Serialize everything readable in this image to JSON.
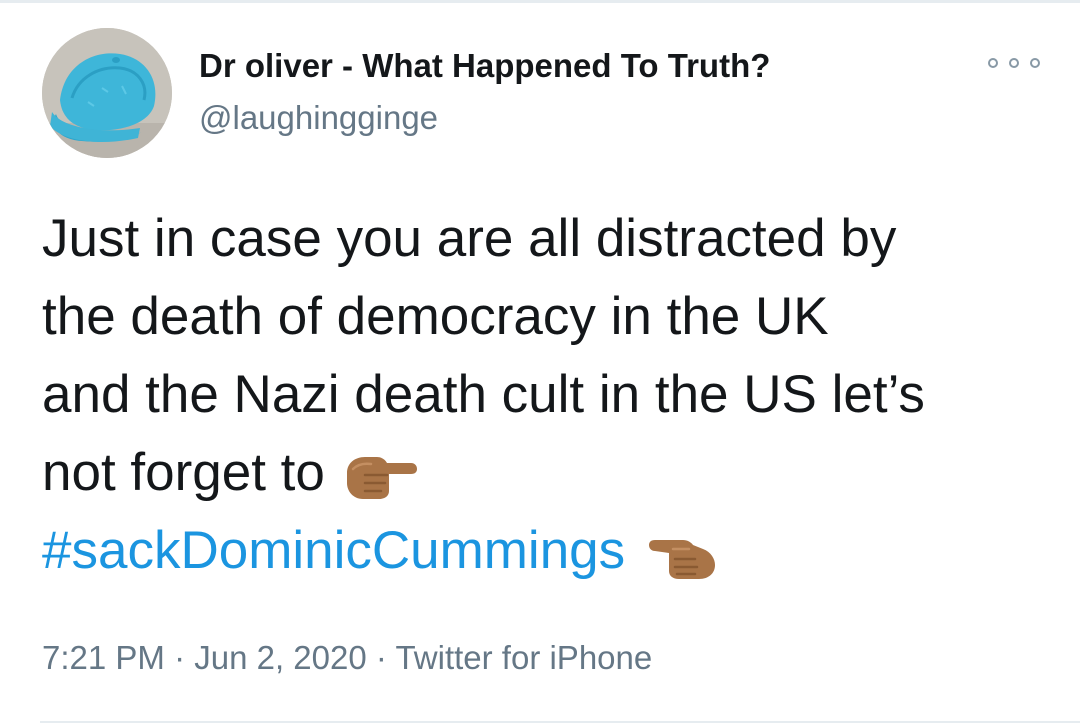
{
  "tweet": {
    "author": {
      "display_name": "Dr oliver - What Happened To Truth?",
      "handle": "@laughingginge"
    },
    "text_lines": [
      "Just in case you are all distracted by",
      "the death of democracy in the UK",
      "and the Nazi death cult in the US let’s",
      "not forget to"
    ],
    "hashtag": "#sackDominicCummings",
    "meta": {
      "time": "7:21 PM",
      "separator": " · ",
      "date": "Jun 2, 2020",
      "source": "Twitter for iPhone"
    },
    "icons": {
      "more": "more-options-icon",
      "emoji_1": "backhand-index-pointing-right-medium-skin",
      "emoji_2": "backhand-index-pointing-right-medium-skin"
    },
    "colors": {
      "text": "#14171a",
      "secondary": "#657786",
      "link": "#1b95e0",
      "border": "#e6ecf0",
      "emoji_skin": "#a97447"
    }
  }
}
